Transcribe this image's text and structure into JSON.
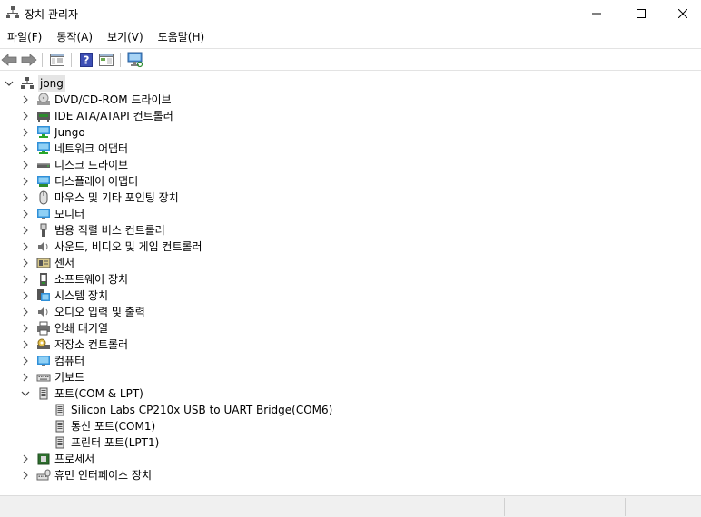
{
  "window": {
    "title": "장치 관리자"
  },
  "menu": [
    "파일(F)",
    "동작(A)",
    "보기(V)",
    "도움말(H)"
  ],
  "toolbar": [
    "back-icon",
    "forward-icon",
    "properties-icon",
    "help-icon",
    "view-icon",
    "monitor-scan-icon"
  ],
  "tree": {
    "root": "jong",
    "categories": [
      "DVD/CD-ROM 드라이브",
      "IDE ATA/ATAPI 컨트롤러",
      "Jungo",
      "네트워크 어댑터",
      "디스크 드라이브",
      "디스플레이 어댑터",
      "마우스 및 기타 포인팅 장치",
      "모니터",
      "범용 직렬 버스 컨트롤러",
      "사운드, 비디오 및 게임 컨트롤러",
      "센서",
      "소프트웨어 장치",
      "시스템 장치",
      "오디오 입력 및 출력",
      "인쇄 대기열",
      "저장소 컨트롤러",
      "컴퓨터",
      "키보드",
      "포트(COM & LPT)",
      "프로세서",
      "휴먼 인터페이스 장치"
    ],
    "ports_children": [
      "Silicon Labs CP210x USB to UART Bridge(COM6)",
      "통신 포트(COM1)",
      "프린터 포트(LPT1)"
    ]
  }
}
